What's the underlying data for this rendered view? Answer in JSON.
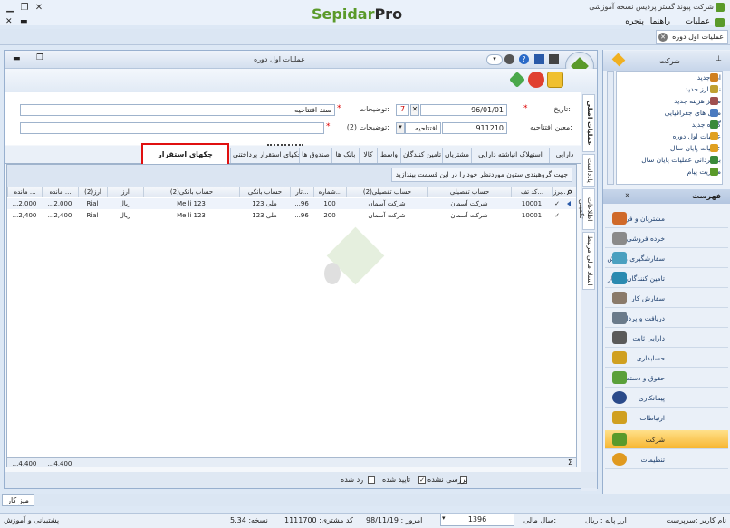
{
  "app": {
    "title": "شرکت پیوند گستر پردیس نسخه آموزشی",
    "logo_left": "Sepidar",
    "logo_right": "Pro"
  },
  "menu": [
    "عملیات",
    "راهنما",
    "پنجره"
  ],
  "doc_tab": "عملیات اول دوره",
  "window": {
    "title": "عملیات اول دوره"
  },
  "form": {
    "date_label": "تاریخ:",
    "date_value": "96/01/01",
    "desc_label": "توضیحات:",
    "desc_value": "سند افتتاحیه",
    "opening_label": "معین افتتاحیه:",
    "opening_code": "911210",
    "opening_name": "افتتاحیه",
    "desc2_label": "توضیحات (2):",
    "desc2_value": ""
  },
  "tabs": [
    "دارایی",
    "استهلاک انباشته دارایی",
    "مشتریان",
    "تامین کنندگان",
    "واسط",
    "کالا",
    "بانک ها",
    "صندوق ها",
    "چکهای استقرار پرداختنی",
    "چکهای استقرار دریافتی"
  ],
  "vertical_tabs": [
    "عملیات اصلی",
    "یادداشت",
    "اطلاعات تکمیلی",
    "اسناد مالی مرتبط"
  ],
  "grid": {
    "group_hint": "جهت گروهبندی ستون موردنظر خود را در این قسمت بیندازید",
    "headers": [
      "برز...",
      "کد تف...",
      "حساب تفصیلی",
      "حساب تفصیلی(2)",
      "شماره...",
      "تار...",
      "حساب بانکی",
      "حساب بانکی(2)",
      "ارز",
      "ارز(2)",
      "مانده ...",
      "مانده ..."
    ],
    "rows": [
      [
        "✓",
        "10001",
        "شرکت آسمان",
        "شرکت آسمان",
        "100",
        "...96",
        "ملی 123",
        "Melli 123",
        "ریال",
        "Rial",
        "...2,000",
        "...2,000"
      ],
      [
        "✓",
        "10001",
        "شرکت آسمان",
        "شرکت آسمان",
        "200",
        "...96",
        "ملی 123",
        "Melli 123",
        "ریال",
        "Rial",
        "...2,400",
        "...2,400"
      ]
    ],
    "footer": [
      "...4,400",
      "...4,400"
    ]
  },
  "status": {
    "unreviewed": "بررسی نشده",
    "approved": "تایید شده",
    "rejected": "رد شده"
  },
  "taskbar": {
    "desk": "میز کار"
  },
  "sidebar": {
    "header": "شرکت",
    "items": [
      "ارز جدید",
      "نرخ ارز جدید",
      "مرکز هزینه جدید",
      "محل های جغرافیایی",
      "گروه جدید",
      "عملیات اول دوره",
      "عملیات پایان سال",
      "بازگردانی عملیات پایان سال",
      "مدیریت پیام"
    ],
    "section": "فهرست",
    "nav": [
      "مشتریان و فروش",
      "خرده فروشی",
      "سفارشگیری و پخش",
      "تامین کنندگان و انبار",
      "سفارش کار",
      "دریافت و پرداخت",
      "دارایی ثابت",
      "حسابداری",
      "حقوق و دستمزد",
      "پیمانکاری",
      "ارتباطات",
      "شرکت",
      "تنظیمات"
    ]
  },
  "bottom": {
    "user": "نام کاربر :سرپرست",
    "base_currency": "ارز پایه : ریال",
    "fiscal_label": "سال مالی:",
    "fiscal_value": "1396",
    "today": "امروز : 98/11/19",
    "customer": "کد مشتری: 1111700",
    "version": "نسخه: 5.34",
    "support": "پشتیبانی و آموزش"
  }
}
